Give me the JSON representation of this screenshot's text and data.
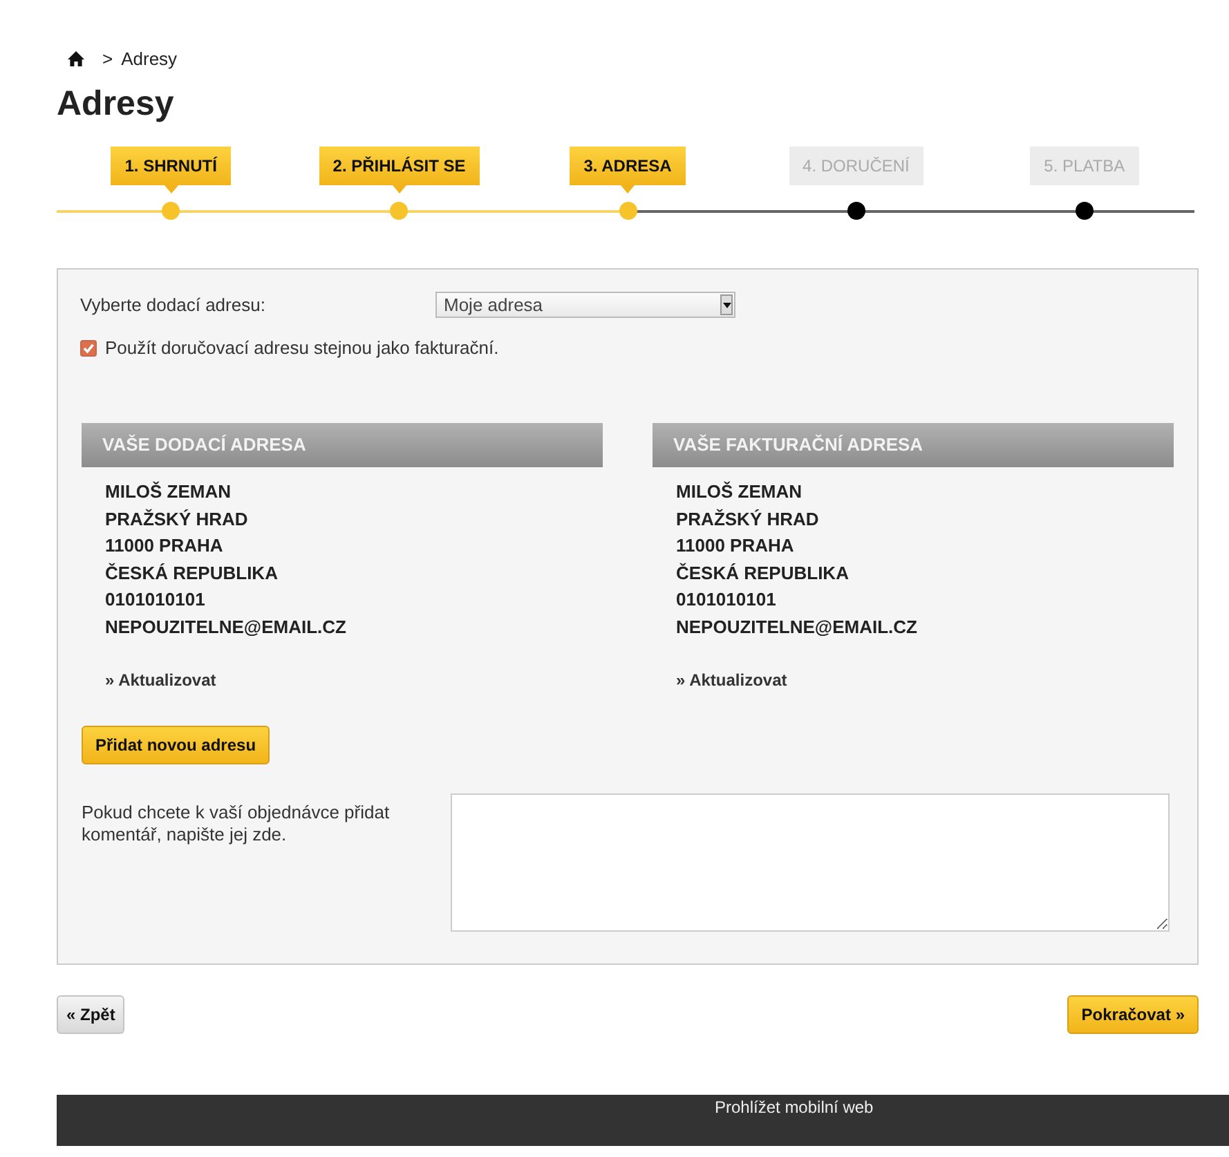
{
  "breadcrumb": {
    "current": "Adresy",
    "separator": ">"
  },
  "title": "Adresy",
  "steps": [
    {
      "label": "1. SHRNUTÍ",
      "reached": true
    },
    {
      "label": "2. PŘIHLÁSIT SE",
      "reached": true
    },
    {
      "label": "3. ADRESA",
      "reached": true
    },
    {
      "label": "4. DORUČENÍ",
      "reached": false
    },
    {
      "label": "5. PLATBA",
      "reached": false
    }
  ],
  "delivery_select": {
    "label": "Vyberte dodací adresu:",
    "value": "Moje adresa"
  },
  "same_address": {
    "label": "Použít doručovací adresu stejnou jako fakturační.",
    "checked": true
  },
  "addresses": [
    {
      "heading": "VAŠE DODACÍ ADRESA",
      "lines": [
        "MILOŠ ZEMAN",
        "PRAŽSKÝ HRAD",
        "11000 PRAHA",
        "ČESKÁ REPUBLIKA",
        "0101010101",
        "NEPOUZITELNE@EMAIL.CZ"
      ],
      "link": "» Aktualizovat"
    },
    {
      "heading": "VAŠE FAKTURAČNÍ ADRESA",
      "lines": [
        "MILOŠ ZEMAN",
        "PRAŽSKÝ HRAD",
        "11000 PRAHA",
        "ČESKÁ REPUBLIKA",
        "0101010101",
        "NEPOUZITELNE@EMAIL.CZ"
      ],
      "link": "» Aktualizovat"
    }
  ],
  "add_button": "Přidat novou adresu",
  "comment": {
    "label": "Pokud chcete k vaší objednávce přidat komentář, napište jej zde."
  },
  "back_button": "« Zpět",
  "continue_button": "Pokračovat »",
  "footer": {
    "link": "Prohlížet mobilní web"
  }
}
